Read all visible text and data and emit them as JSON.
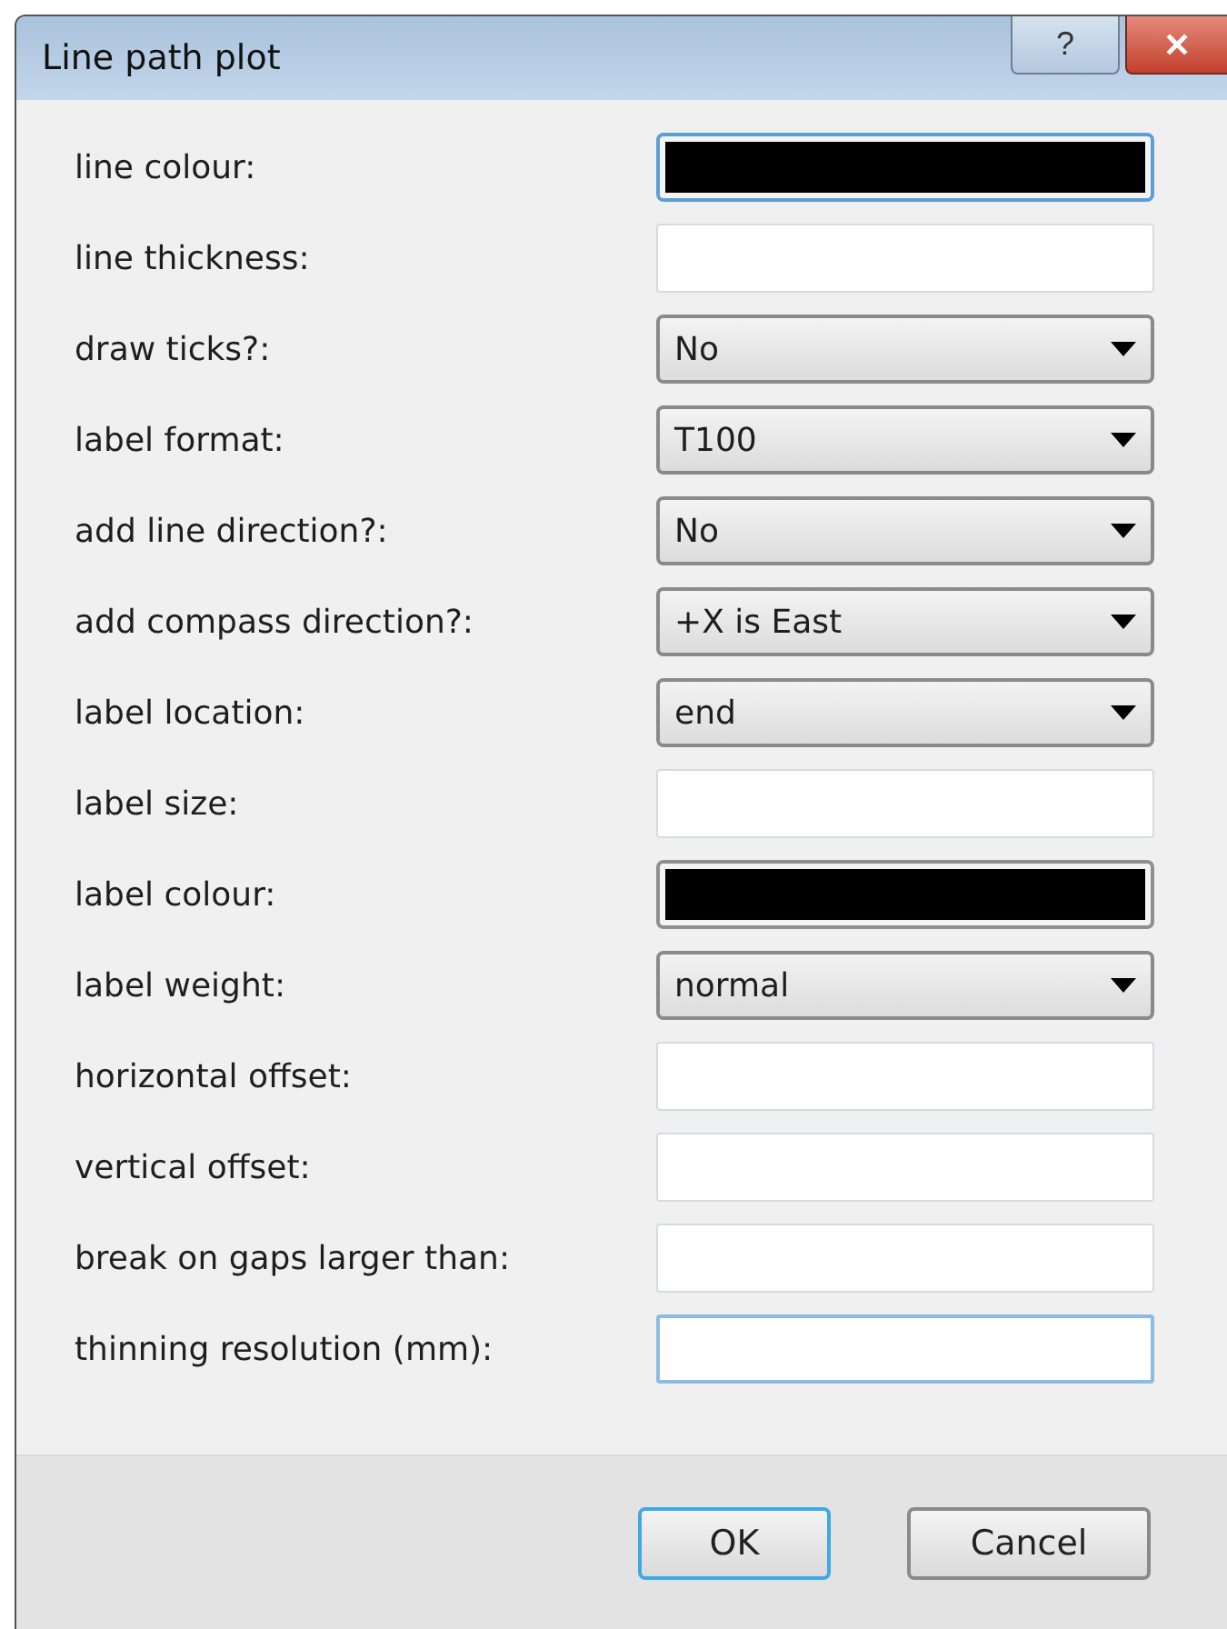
{
  "window": {
    "title": "Line path plot",
    "buttons": [
      "?",
      "✕"
    ]
  },
  "fields": [
    {
      "label": "line colour:",
      "kind": "color",
      "color": "#000000",
      "focused": true
    },
    {
      "label": "line thickness:",
      "kind": "text",
      "focused": false
    },
    {
      "label": "draw ticks?:",
      "kind": "select",
      "value": "No"
    },
    {
      "label": "label format:",
      "kind": "select",
      "value": "T100"
    },
    {
      "label": "add line direction?:",
      "kind": "select",
      "value": "No"
    },
    {
      "label": "add compass direction?:",
      "kind": "select",
      "value": "+X is East"
    },
    {
      "label": "label location:",
      "kind": "select",
      "value": "end"
    },
    {
      "label": "label size:",
      "kind": "text",
      "focused": false
    },
    {
      "label": "label colour:",
      "kind": "color",
      "color": "#000000",
      "focused": false
    },
    {
      "label": "label weight:",
      "kind": "select",
      "value": "normal"
    },
    {
      "label": "horizontal offset:",
      "kind": "text",
      "focused": false
    },
    {
      "label": "vertical offset:",
      "kind": "text",
      "focused": false
    },
    {
      "label": "break on gaps larger than:",
      "kind": "text",
      "focused": false
    },
    {
      "label": "thinning resolution (mm):",
      "kind": "text",
      "focused": true
    }
  ],
  "buttons": [
    {
      "label": "OK",
      "default": true
    },
    {
      "label": "Cancel",
      "default": false
    }
  ]
}
